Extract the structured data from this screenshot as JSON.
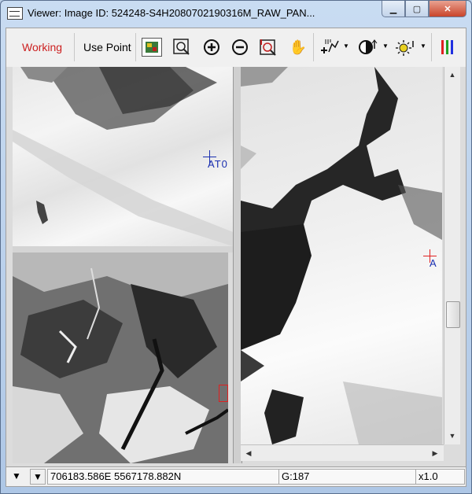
{
  "window": {
    "title": "Viewer: Image ID: 524248-S4H2080702190316M_RAW_PAN..."
  },
  "toolbar": {
    "working_label": "Working",
    "use_point_label": "Use Point"
  },
  "colors": {
    "working_text": "#cc2020",
    "marker_blue": "#1a2fb0",
    "marker_red": "#e02020",
    "window_frame": "#bcd0e8"
  },
  "markers": {
    "top_left_label": "AT0",
    "right_label": "A"
  },
  "status": {
    "coordinates": "706183.586E 5567178.882N",
    "value": "G:187",
    "zoom": "x1.0"
  },
  "icons": [
    "app-icon",
    "minimize-icon",
    "maximize-icon",
    "close-icon",
    "fit-image-icon",
    "zoom-box-icon",
    "zoom-in-icon",
    "zoom-out-icon",
    "zoom-point-icon",
    "pan-hand-icon",
    "point-tool-icon",
    "contrast-icon",
    "brightness-icon",
    "band-combination-icon"
  ]
}
